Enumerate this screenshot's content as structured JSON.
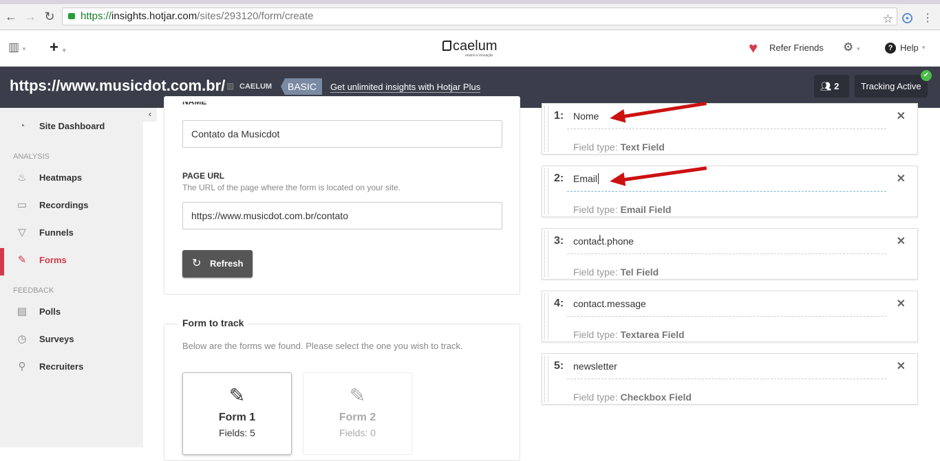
{
  "browser": {
    "url_scheme": "https://",
    "url_host": "insights.hotjar.com",
    "url_path": "/sites/293120/form/create"
  },
  "header": {
    "logo": "caelum",
    "logo_tagline": "ensino e inovação",
    "refer": "Refer Friends",
    "help": "Help"
  },
  "sitebar": {
    "site_url": "https://www.musicdot.com.br/",
    "org": "CAELUM",
    "plan": "BASIC",
    "upgrade": "Get unlimited insights with Hotjar Plus",
    "users": "2",
    "tracking": "Tracking Active"
  },
  "sidebar": {
    "dashboard": "Site Dashboard",
    "analysis": "ANALYSIS",
    "heatmaps": "Heatmaps",
    "recordings": "Recordings",
    "funnels": "Funnels",
    "forms": "Forms",
    "feedback": "FEEDBACK",
    "polls": "Polls",
    "surveys": "Surveys",
    "recruiters": "Recruiters"
  },
  "form": {
    "name_label": "NAME",
    "name_value": "Contato da Musicdot",
    "url_label": "PAGE URL",
    "url_help": "The URL of the page where the form is located on your site.",
    "url_value": "https://www.musicdot.com.br/contato",
    "refresh": "Refresh"
  },
  "track": {
    "title": "Form to track",
    "help": "Below are the forms we found. Please select the one you wish to track.",
    "forms": [
      {
        "title": "Form 1",
        "fields": "Fields: 5"
      },
      {
        "title": "Form 2",
        "fields": "Fields: 0"
      }
    ]
  },
  "fields": [
    {
      "num": "1:",
      "name": "Nome",
      "type_label": "Field type:",
      "type": "Text Field"
    },
    {
      "num": "2:",
      "name": "Email",
      "type_label": "Field type:",
      "type": "Email Field"
    },
    {
      "num": "3:",
      "name": "contact.phone",
      "type_label": "Field type:",
      "type": "Tel Field"
    },
    {
      "num": "4:",
      "name": "contact.message",
      "type_label": "Field type:",
      "type": "Textarea Field"
    },
    {
      "num": "5:",
      "name": "newsletter",
      "type_label": "Field type:",
      "type": "Checkbox Field"
    }
  ],
  "colors": {
    "accent": "#d23b4e",
    "dark": "#3b3e4a"
  }
}
